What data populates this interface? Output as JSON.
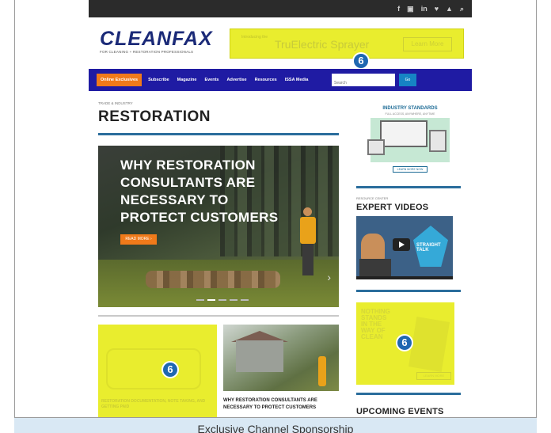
{
  "social_icons": [
    "f",
    "▣",
    "in",
    "♥",
    "▲",
    "⌕"
  ],
  "logo": {
    "name": "CLEANFAX",
    "tagline": "FOR CLEANING + RESTORATION PROFESSIONALS"
  },
  "banner_ad": {
    "left_text": "Introducing\nthe",
    "title": "TruElectric Sprayer",
    "button": "Learn More",
    "badge": "6"
  },
  "nav": {
    "items": [
      "Online Exclusives",
      "Subscribe",
      "Magazine",
      "Events",
      "Advertise",
      "Resources",
      "ISSA Media"
    ],
    "search_placeholder": "Search",
    "go": "Go"
  },
  "main": {
    "breadcrumb": "TRADE & INDUSTRY",
    "title": "RESTORATION",
    "hero": {
      "headline": "WHY RESTORATION CONSULTANTS ARE NECESSARY TO PROTECT CUSTOMERS",
      "button": "READ MORE ›",
      "arrow": "›"
    },
    "card_ad": {
      "caption": "RESTORATION DOCUMENTATION, NOTE TAKING, AND GETTING PAID",
      "badge": "6"
    },
    "card_story": {
      "title": "WHY RESTORATION CONSULTANTS ARE NECESSARY TO PROTECT CUSTOMERS"
    }
  },
  "sidebar": {
    "standards": {
      "title": "INDUSTRY STANDARDS",
      "sub": "FULL ACCESS, ANYWHERE, ANYTIME",
      "button": "LEARN MORE NOW"
    },
    "videos_label": "RESOURCE CENTER",
    "videos_heading": "EXPERT VIDEOS",
    "video_promo": "STRAIGHT TALK",
    "ad": {
      "text": "NOTHING\nSTANDS\nIN THE\nWAY OF\nCLEAN",
      "button": "LEARN MORE",
      "badge": "6"
    },
    "events_heading": "UPCOMING EVENTS"
  },
  "caption": "Exclusive Channel Sponsorship"
}
